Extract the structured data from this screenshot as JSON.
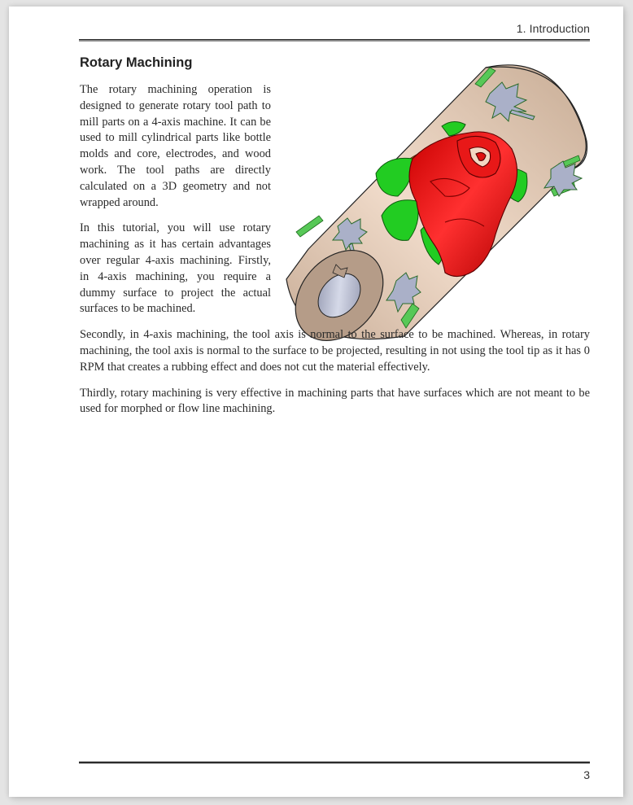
{
  "header": {
    "chapter": "1. Introduction"
  },
  "section": {
    "title": "Rotary Machining"
  },
  "paragraphs": [
    "The rotary machining operation is designed to generate rotary tool path to mill parts on a 4-axis machine. It can be used to mill cylindrical parts like bottle molds and core, electrodes, and wood work. The tool paths are directly calculated on a 3D geometry and not wrapped around.",
    "In this tutorial, you will use rotary machining as it has certain advantages over regular 4-axis machining. Firstly, in 4-axis machining, you require a dummy surface to project the actual surfaces to be machined.",
    "Secondly, in 4-axis machining, the tool axis is normal to the surface to be machined. Whereas, in rotary machining, the tool axis is normal to the surface to be projected, resulting in not using the tool tip as it has 0 RPM that creates a rubbing effect and does not cut the material effectively.",
    "Thirdly, rotary machining is very effective in machining parts that have surfaces which are not meant  to be used for morphed or flow line machining."
  ],
  "figure": {
    "description": "3D rendered cylindrical part with embossed red rose, green leaves and grey maple-leaf reliefs",
    "colors": {
      "cylinder": "#e3c9b4",
      "cylinder_end": "#b59c88",
      "bore": "#a9aec4",
      "rose": "#e01010",
      "leaf": "#22cc22",
      "maple": "#aab0c8",
      "stem": "#9a5a22"
    }
  },
  "footer": {
    "page_number": "3"
  }
}
